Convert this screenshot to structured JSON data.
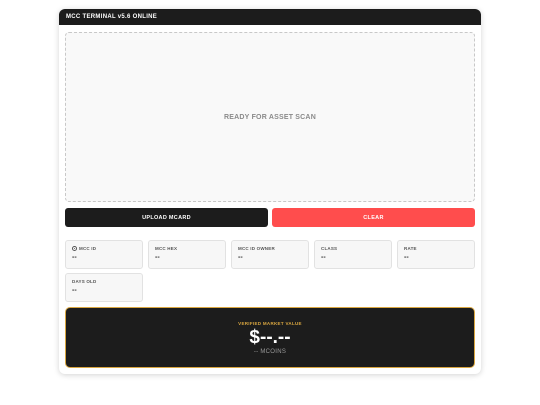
{
  "window": {
    "title": "MCC TERMINAL v5.6 ONLINE"
  },
  "scan_area": {
    "text": "READY FOR ASSET SCAN"
  },
  "actions": {
    "upload_label": "UPLOAD MCARD",
    "clear_label": "CLEAR"
  },
  "fields": [
    {
      "label": "MCC ID",
      "value": "--",
      "icon": "id-icon"
    },
    {
      "label": "MCC HEX",
      "value": "--"
    },
    {
      "label": "MCC ID OWNER",
      "value": "--"
    },
    {
      "label": "CLASS",
      "value": "--"
    },
    {
      "label": "RATE",
      "value": "--"
    },
    {
      "label": "DAYS OLD",
      "value": "--"
    }
  ],
  "market_value": {
    "label": "VERIFIED MARKET VALUE",
    "amount": "$--.--",
    "unit": "-- MCOINS"
  },
  "colors": {
    "dark": "#1c1c1c",
    "clear_button": "#ff4d4d",
    "gold_accent": "#d9a640"
  }
}
